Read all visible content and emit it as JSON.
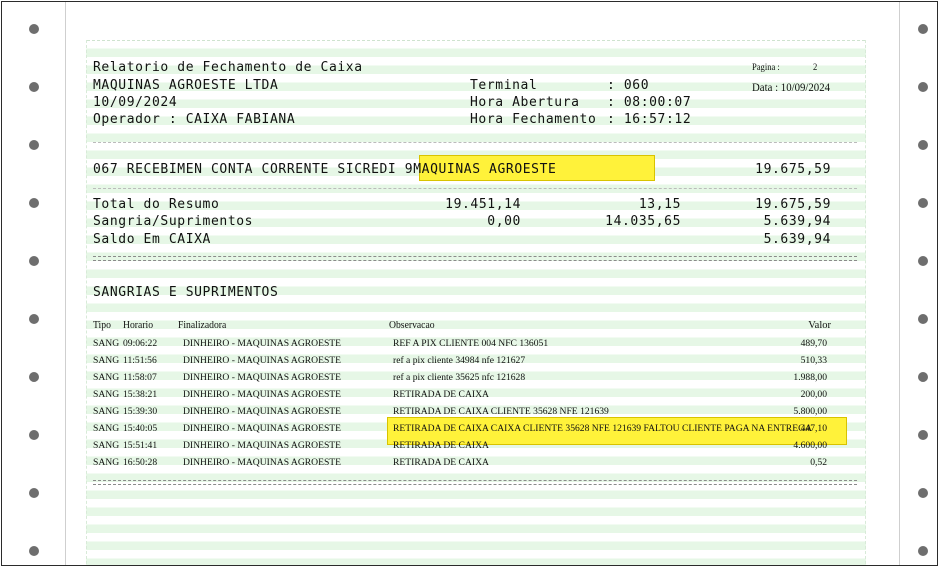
{
  "report": {
    "title": "Relatorio de Fechamento de Caixa",
    "page_label": "Pagina :",
    "page_number": "2",
    "company": "MAQUINAS AGROESTE LTDA",
    "report_date": "10/09/2024",
    "data_label": "Data : 10/09/2024",
    "operator": "Operador : CAIXA FABIANA",
    "terminal_label": "Terminal",
    "terminal_value": ": 060",
    "open_label": "Hora Abertura",
    "open_value": ": 08:00:07",
    "close_label": "Hora Fechamento",
    "close_value": ": 16:57:12"
  },
  "summary_line": {
    "text": "067 RECEBIMEN CONTA CORRENTE SICREDI 9MAQUINAS AGROESTE",
    "value": "19.675,59"
  },
  "totals": [
    {
      "label": "Total do Resumo",
      "a": "19.451,14",
      "b": "13,15",
      "c": "19.675,59"
    },
    {
      "label": "Sangria/Suprimentos",
      "a": "0,00",
      "b": "14.035,65",
      "c": "5.639,94"
    },
    {
      "label": "Saldo Em CAIXA",
      "a": "",
      "b": "",
      "c": "5.639,94"
    }
  ],
  "section_title": "SANGRIAS E SUPRIMENTOS",
  "table": {
    "headers": {
      "tipo": "Tipo",
      "horario": "Horario",
      "finalizadora": "Finalizadora",
      "observacao": "Observacao",
      "valor": "Valor"
    },
    "rows": [
      {
        "tipo": "SANG",
        "horario": "09:06:22",
        "finalizadora": "DINHEIRO - MAQUINAS AGROESTE",
        "obs": "REF A PIX CLIENTE 004 NFC 136051",
        "valor": "489,70"
      },
      {
        "tipo": "SANG",
        "horario": "11:51:56",
        "finalizadora": "DINHEIRO - MAQUINAS AGROESTE",
        "obs": "ref a pix cliente 34984 nfe 121627",
        "valor": "510,33"
      },
      {
        "tipo": "SANG",
        "horario": "11:58:07",
        "finalizadora": "DINHEIRO - MAQUINAS AGROESTE",
        "obs": "ref a pix cliente 35625 nfc 121628",
        "valor": "1.988,00"
      },
      {
        "tipo": "SANG",
        "horario": "15:38:21",
        "finalizadora": "DINHEIRO - MAQUINAS AGROESTE",
        "obs": "RETIRADA DE CAIXA",
        "valor": "200,00"
      },
      {
        "tipo": "SANG",
        "horario": "15:39:30",
        "finalizadora": "DINHEIRO - MAQUINAS AGROESTE",
        "obs": "RETIRADA DE CAIXA CLIENTE 35628 NFE 121639",
        "valor": "5.800,00"
      },
      {
        "tipo": "SANG",
        "horario": "15:40:05",
        "finalizadora": "DINHEIRO - MAQUINAS AGROESTE",
        "obs": "RETIRADA DE CAIXA CAIXA CLIENTE 35628 NFE 121639  FALTOU CLIENTE PAGA NA ENTREGA",
        "valor": "447,10"
      },
      {
        "tipo": "SANG",
        "horario": "15:51:41",
        "finalizadora": "DINHEIRO - MAQUINAS AGROESTE",
        "obs": "RETIRADA DE CAIXA",
        "valor": "4.600,00"
      },
      {
        "tipo": "SANG",
        "horario": "16:50:28",
        "finalizadora": "DINHEIRO - MAQUINAS AGROESTE",
        "obs": "RETIRADA DE CAIXA",
        "valor": "0,52"
      }
    ]
  },
  "highlight_color": "#fff23a",
  "stripe_color": "#e6f7e6"
}
